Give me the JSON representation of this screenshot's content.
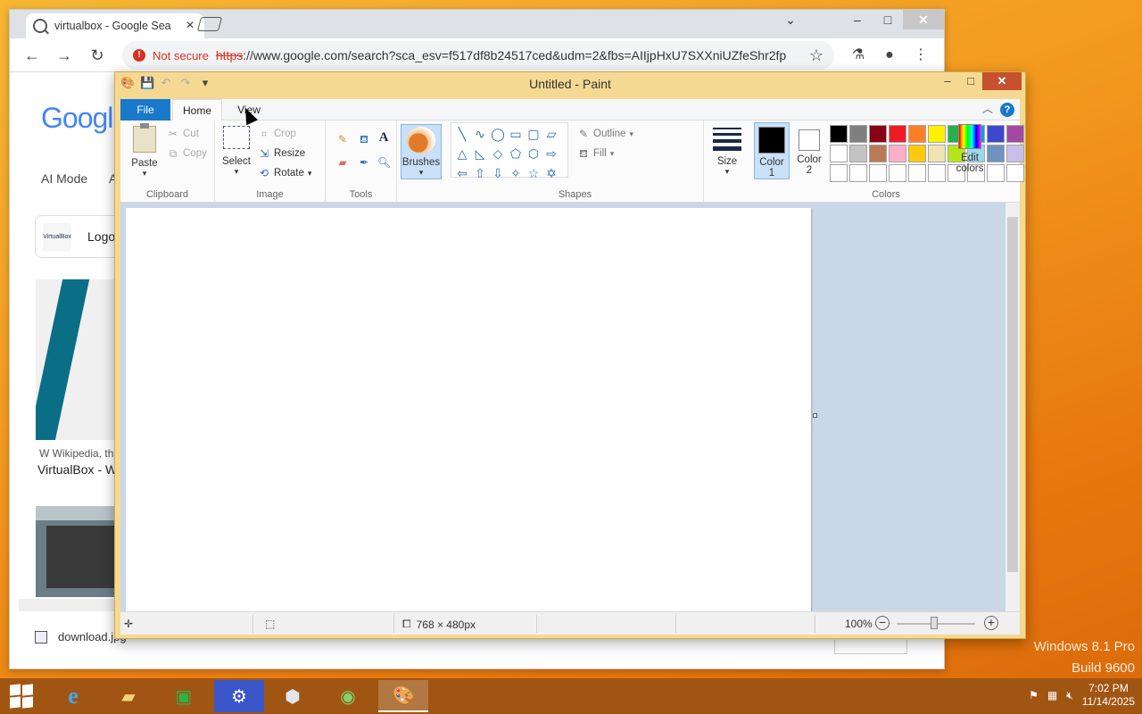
{
  "chrome": {
    "tab_title": "virtualbox - Google Sea",
    "tab_close": "×",
    "not_secure": "Not secure",
    "url_scheme": "https",
    "url_rest": "://www.google.com/search?sca_esv=f517df8b24517ced&udm=2&fbs=AIIjpHxU7SXXniUZfeShr2fp...",
    "minimize": "–",
    "maximize": "□",
    "close": "✕",
    "tab_search": "⌄"
  },
  "google": {
    "logo": "Googl",
    "ai_mode": "AI Mode",
    "ai_mode_cut": "A",
    "card_thumb_text": "VirtualBox",
    "card_label": "Logo",
    "wiki_source": "Wikipedia, th",
    "result_title": "VirtualBox - W",
    "download_file": "download.jpg"
  },
  "paint": {
    "title": "Untitled - Paint",
    "tabs": {
      "file": "File",
      "home": "Home",
      "view": "View"
    },
    "clipboard": {
      "paste": "Paste",
      "cut": "Cut",
      "copy": "Copy",
      "label": "Clipboard"
    },
    "image": {
      "select": "Select",
      "crop": "Crop",
      "resize": "Resize",
      "rotate": "Rotate",
      "label": "Image"
    },
    "tools": {
      "label": "Tools"
    },
    "brushes": "Brushes",
    "shapes": {
      "outline": "Outline",
      "fill": "Fill",
      "label": "Shapes"
    },
    "size": "Size",
    "color1": {
      "line1": "Color",
      "line2": "1"
    },
    "color2": {
      "line1": "Color",
      "line2": "2"
    },
    "colors_label": "Colors",
    "edit_colors": {
      "line1": "Edit",
      "line2": "colors"
    },
    "palette": [
      "#000000",
      "#7f7f7f",
      "#880015",
      "#ed1c24",
      "#ff7f27",
      "#fff200",
      "#22b14c",
      "#00a2e8",
      "#3f48cc",
      "#a349a4",
      "#ffffff",
      "#c3c3c3",
      "#b97a57",
      "#ffaec9",
      "#ffc90e",
      "#efe4b0",
      "#b5e61d",
      "#99d9ea",
      "#7092be",
      "#c8bfe7",
      "#ffffff",
      "#ffffff",
      "#ffffff",
      "#ffffff",
      "#ffffff",
      "#ffffff",
      "#ffffff",
      "#ffffff",
      "#ffffff",
      "#ffffff"
    ],
    "status": {
      "dimensions": "768 × 480px",
      "zoom": "100%"
    }
  },
  "desktop": {
    "watermark_line1": "Windows 8.1 Pro",
    "watermark_line2": "Build 9600"
  },
  "taskbar": {
    "time": "7:02 PM",
    "date": "11/14/2025"
  }
}
